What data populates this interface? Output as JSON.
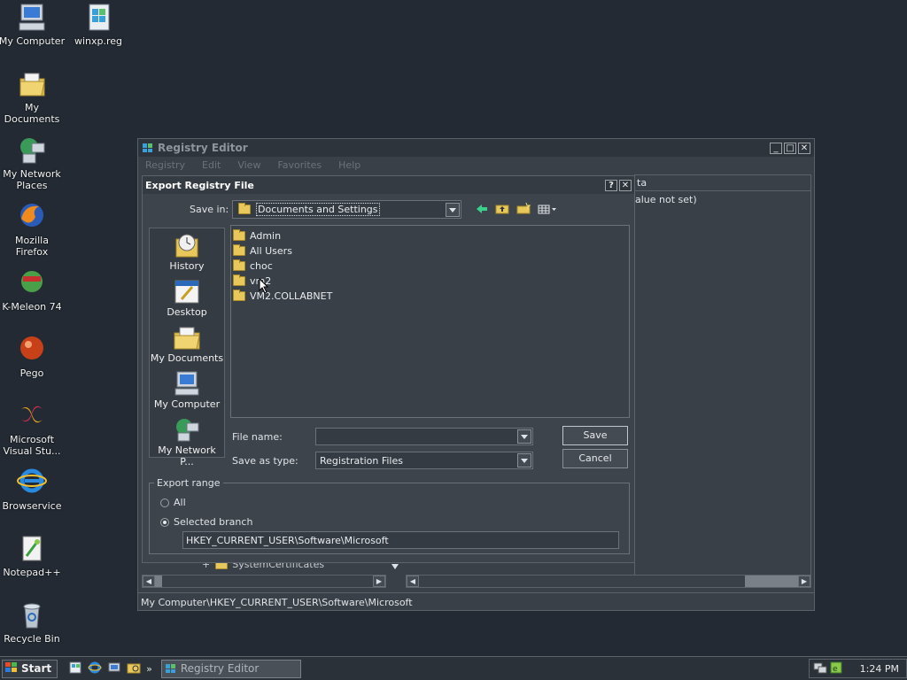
{
  "desktop": {
    "icons": [
      {
        "label": "My Computer",
        "icon": "computer-icon"
      },
      {
        "label": "winxp.reg",
        "icon": "reg-file-icon"
      },
      {
        "label": "My Documents",
        "icon": "documents-folder-icon"
      },
      {
        "label": "My Network Places",
        "icon": "network-icon"
      },
      {
        "label": "Mozilla Firefox",
        "icon": "firefox-icon"
      },
      {
        "label": "K-Meleon 74",
        "icon": "kmeleon-icon"
      },
      {
        "label": "Pego",
        "icon": "pego-icon"
      },
      {
        "label": "Microsoft Visual Stu...",
        "icon": "visual-studio-icon"
      },
      {
        "label": "Browservice",
        "icon": "ie-icon"
      },
      {
        "label": "Notepad++",
        "icon": "notepadpp-icon"
      },
      {
        "label": "Recycle Bin",
        "icon": "recycle-bin-icon"
      }
    ]
  },
  "regedit": {
    "title": "Registry Editor",
    "menu": [
      "Registry",
      "Edit",
      "View",
      "Favorites",
      "Help"
    ],
    "right_header": "ta",
    "right_value": "alue not set)",
    "tree_partial": "SystemCertificates",
    "status": "My Computer\\HKEY_CURRENT_USER\\Software\\Microsoft"
  },
  "dialog": {
    "title": "Export Registry File",
    "save_in_label": "Save in:",
    "save_in_value": "Documents and Settings",
    "places": [
      "History",
      "Desktop",
      "My Documents",
      "My Computer",
      "My Network P..."
    ],
    "files": [
      "Admin",
      "All Users",
      "choc",
      "vm2",
      "VM2.COLLABNET"
    ],
    "file_name_label": "File name:",
    "file_name_value": "",
    "save_type_label": "Save as type:",
    "save_type_value": "Registration Files",
    "save_button": "Save",
    "cancel_button": "Cancel",
    "export_range_label": "Export range",
    "option_all": "All",
    "option_selected": "Selected branch",
    "branch_value": "HKEY_CURRENT_USER\\Software\\Microsoft",
    "selected_option": "Selected branch"
  },
  "taskbar": {
    "start_label": "Start",
    "task_label": "Registry Editor",
    "time": "1:24 PM"
  },
  "colors": {
    "desktop_bg": "#232a33",
    "folder": "#e8c85a",
    "accent_green": "#3bd18a"
  }
}
